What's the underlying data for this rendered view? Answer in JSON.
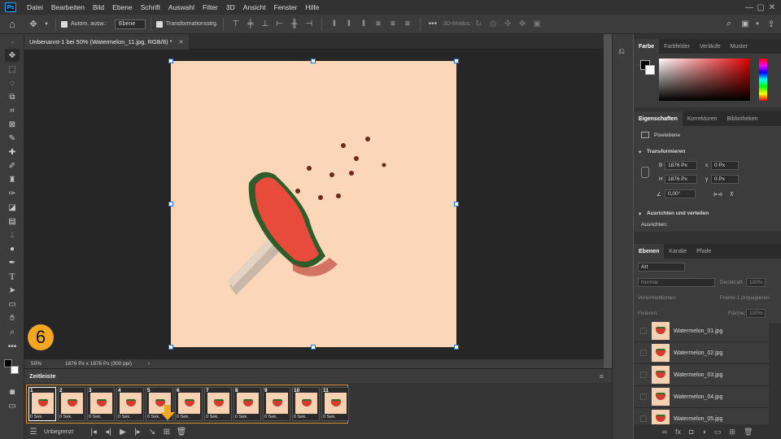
{
  "menubar": {
    "items": [
      "Datei",
      "Bearbeiten",
      "Bild",
      "Ebene",
      "Schrift",
      "Auswahl",
      "Filter",
      "3D",
      "Ansicht",
      "Fenster",
      "Hilfe"
    ]
  },
  "options": {
    "auto_select_label": "Autom. ausw.:",
    "auto_select_value": "Ebene",
    "transform_label": "Transformationsstrg.",
    "mode_3d_label": "3D-Modus:"
  },
  "document": {
    "tab_title": "Unbenannt-1 bei 50% (Watermelon_11.jpg, RGB/8) *",
    "zoom": "50%",
    "size_info": "1876 Px x 1876 Px (300 ppi)"
  },
  "badge": "6",
  "timeline": {
    "title": "Zeitleiste",
    "loop": "Unbegrenzt",
    "frames": [
      {
        "num": "1",
        "duration": "0 Sek."
      },
      {
        "num": "2",
        "duration": "0 Sek."
      },
      {
        "num": "3",
        "duration": "0 Sek."
      },
      {
        "num": "4",
        "duration": "0 Sek."
      },
      {
        "num": "5",
        "duration": "0 Sek."
      },
      {
        "num": "6",
        "duration": "0 Sek."
      },
      {
        "num": "7",
        "duration": "0 Sek."
      },
      {
        "num": "8",
        "duration": "0 Sek."
      },
      {
        "num": "9",
        "duration": "0 Sek."
      },
      {
        "num": "10",
        "duration": "0 Sek."
      },
      {
        "num": "11",
        "duration": "0 Sek."
      }
    ]
  },
  "panels": {
    "color_tabs": [
      "Farbe",
      "Farbfelder",
      "Verläufe",
      "Muster"
    ],
    "props_tabs": [
      "Eigenschaften",
      "Korrekturen",
      "Bibliotheken"
    ],
    "pixel_layer": "Pixelebene",
    "transform_title": "Transformieren",
    "w_label": "B",
    "w_value": "1876 Px",
    "h_label": "H",
    "h_value": "1876 Px",
    "x_label": "x",
    "x_value": "0 Px",
    "y_label": "y",
    "y_value": "0 Px",
    "angle_value": "0,00°",
    "align_title": "Ausrichten und verteilen",
    "align_sub": "Ausrichten:",
    "layers_tabs": [
      "Ebenen",
      "Kanäle",
      "Pfade"
    ],
    "layer_filter": "Art",
    "blend_mode": "Normal",
    "opacity_label": "Deckkraft:",
    "opacity_value": "100%",
    "unify_label": "Vereinheitlichen:",
    "propagate_label": "Frame 1 propagieren",
    "lock_label": "Fixieren:",
    "fill_label": "Fläche:",
    "fill_value": "100%",
    "layers": [
      "Watermelon_01.jpg",
      "Watermelon_02.jpg",
      "Watermelon_03.jpg",
      "Watermelon_04.jpg",
      "Watermelon_05.jpg"
    ]
  },
  "colors": {
    "accent": "#d08c2e",
    "badge": "#f5a623",
    "canvas_bg": "#fbd6b8"
  }
}
